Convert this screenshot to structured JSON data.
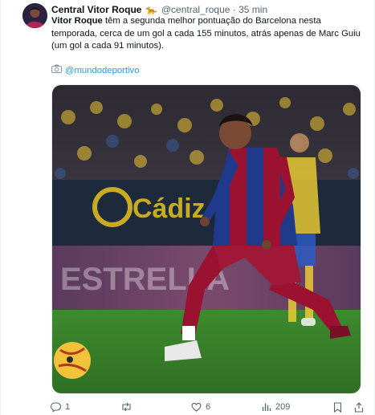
{
  "author": {
    "display_name": "Central Vitor Roque",
    "badge_emoji": "🐆",
    "handle": "@central_roque",
    "separator": "·",
    "time": "35 min"
  },
  "tweet": {
    "bold_lead": "Vitor Roque",
    "body": " têm a segunda melhor pontuação do Barcelona nesta temporada, cerca de um gol a cada 155 minutos, atrás apenas de Marc Guiu (um gol a cada 91 minutos).",
    "credit_icon": "camera-icon",
    "credit_link": "@mundodeportivo"
  },
  "media": {
    "stadium_banner_text": "Cádiz",
    "ad_board_text": "ESTRELLA"
  },
  "actions": {
    "replies": "1",
    "retweets": "",
    "likes": "6",
    "views": "209"
  },
  "colors": {
    "link": "#1d9bf0",
    "muted": "#536471",
    "pitch": "#3f8a2f",
    "barca_blue": "#1f3a8a",
    "barca_red": "#9b1230",
    "cadiz_yellow": "#f2d233"
  }
}
